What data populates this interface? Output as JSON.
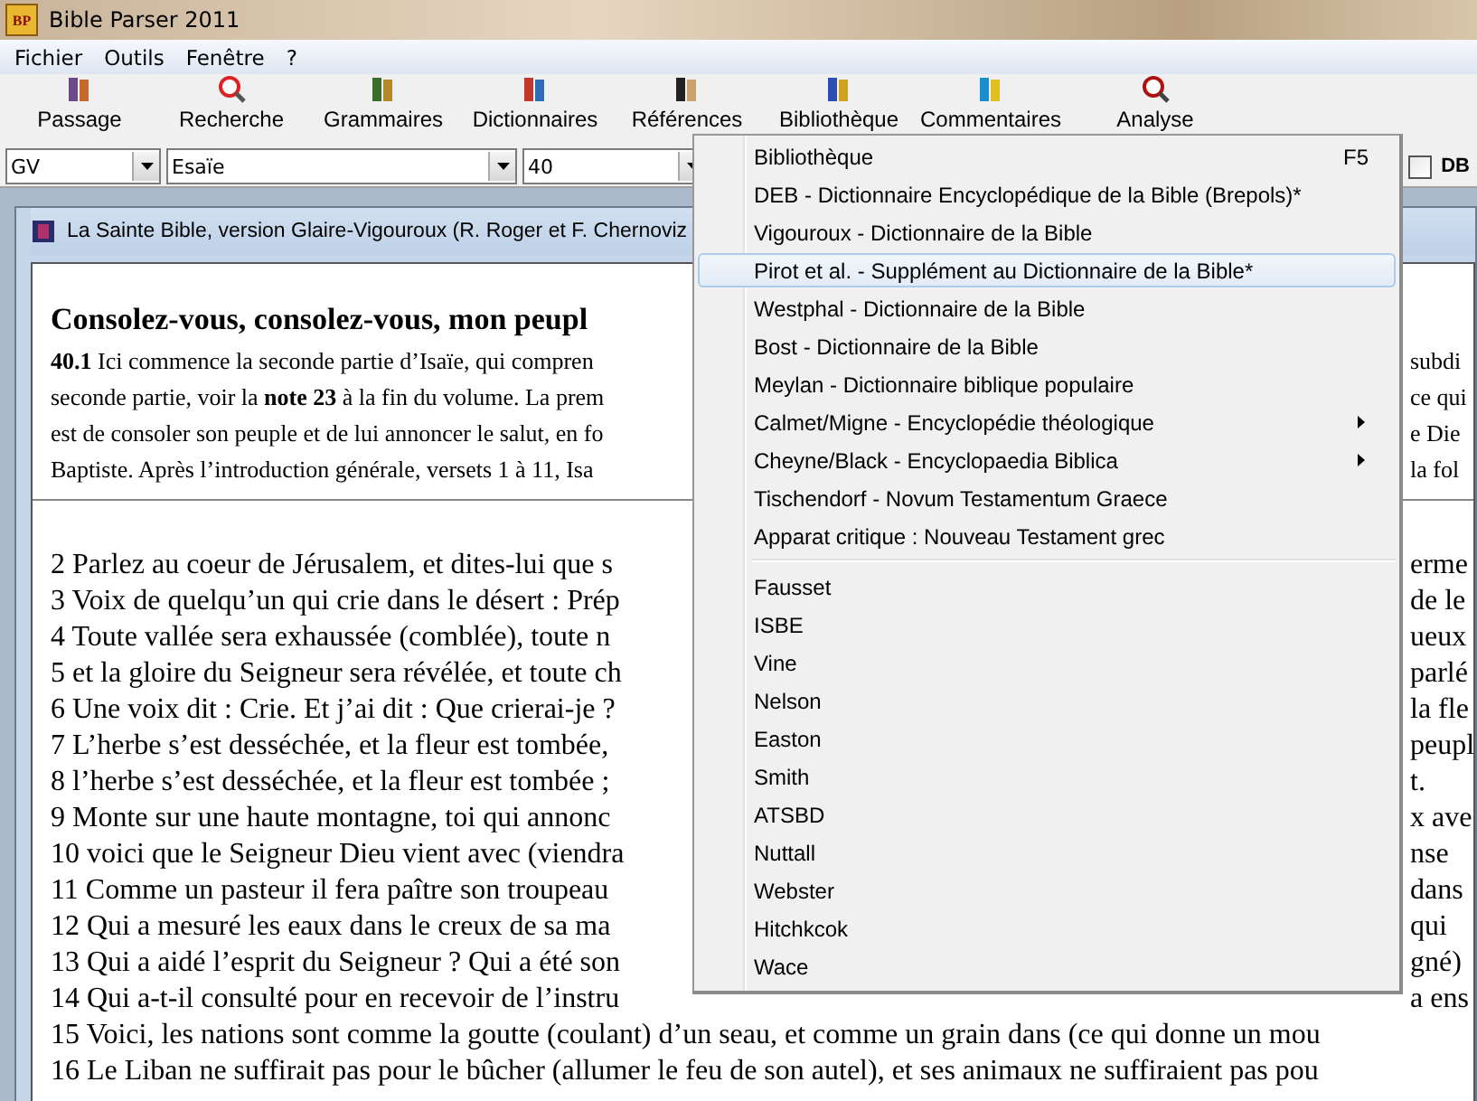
{
  "window": {
    "title": "Bible Parser 2011",
    "logo": "BP"
  },
  "menu_bar": [
    "Fichier",
    "Outils",
    "Fenêtre",
    "?"
  ],
  "toolbar": [
    {
      "label": "Passage"
    },
    {
      "label": "Recherche"
    },
    {
      "label": "Grammaires"
    },
    {
      "label": "Dictionnaires"
    },
    {
      "label": "Références"
    },
    {
      "label": "Bibliothèque"
    },
    {
      "label": "Commentaires"
    },
    {
      "label": "Analyse"
    }
  ],
  "selectors": [
    {
      "value": "GV"
    },
    {
      "value": "Esaïe"
    },
    {
      "value": "40"
    }
  ],
  "db_checkbox": {
    "label": "DB",
    "checked": false
  },
  "document_window": {
    "title": "La Sainte Bible, version Glaire-Vigouroux (R. Roger et F. Chernoviz",
    "heading": "Consolez-vous, consolez-vous, mon peupl",
    "intro": [
      {
        "text": "**40.1** Ici commence la seconde partie d’Isaïe, qui compren",
        "right": "subdi"
      },
      {
        "text": "seconde partie, voir la **note 23** à la fin du volume. La prem",
        "right": "ce qui"
      },
      {
        "text": "est de consoler son peuple et de lui annoncer le salut, en fo",
        "right": "e Die"
      },
      {
        "text": "Baptiste. Après l’introduction générale, versets 1 à 11, Isa",
        "right": "la fol"
      }
    ],
    "verses": [
      {
        "text": "2 Parlez au coeur de Jérusalem, et dites-lui que s",
        "right": "erme"
      },
      {
        "text": "3 Voix de quelqu’un qui crie dans le désert : Prép",
        "right": "de le"
      },
      {
        "text": "4 Toute vallée sera exhaussée (comblée), toute n",
        "right": "ueux"
      },
      {
        "text": "5 et la gloire du Seigneur sera révélée, et toute ch",
        "right": "parlé"
      },
      {
        "text": "6 Une voix dit : Crie. Et j’ai dit : Que crierai-je ?",
        "right": "la fle"
      },
      {
        "text": "7 L’herbe s’est desséchée, et la fleur est tombée,",
        "right": "peupl"
      },
      {
        "text": "8 l’herbe s’est desséchée, et la fleur est tombée ;",
        "right": "t."
      },
      {
        "text": "9 Monte sur une haute montagne, toi qui annonc",
        "right": "x ave"
      },
      {
        "text": "10 voici que le Seigneur Dieu vient avec (viendra",
        "right": "nse"
      },
      {
        "text": "11 Comme un pasteur il fera paître son troupeau",
        "right": "dans"
      },
      {
        "text": "12 Qui a mesuré les eaux dans le creux de sa ma",
        "right": "qui"
      },
      {
        "text": "13 Qui a aidé l’esprit du Seigneur ? Qui a été son",
        "right": "gné)"
      },
      {
        "text": "14 Qui a-t-il consulté pour en recevoir de l’instru",
        "right": "a ens"
      },
      {
        "text": "15 Voici, les nations sont comme la goutte (coulant) d’un seau, et comme un grain dans (ce qui donne un mou"
      },
      {
        "text": "16 Le Liban ne suffirait pas pour le bûcher (allumer le feu de son autel), et ses animaux ne suffiraient pas pou"
      }
    ]
  },
  "context_menu": [
    {
      "kind": "item",
      "label": "Bibliothèque",
      "shortcut": "F5",
      "selected": false
    },
    {
      "kind": "item",
      "label": "DEB - Dictionnaire Encyclopédique de la Bible (Brepols)*",
      "selected": false
    },
    {
      "kind": "item",
      "label": "Vigouroux - Dictionnaire de la Bible",
      "selected": false
    },
    {
      "kind": "item",
      "label": "Pirot et al. - Supplément au Dictionnaire de la Bible*",
      "selected": true
    },
    {
      "kind": "item",
      "label": "Westphal - Dictionnaire de la Bible",
      "selected": false
    },
    {
      "kind": "item",
      "label": "Bost - Dictionnaire de la Bible",
      "selected": false
    },
    {
      "kind": "item",
      "label": "Meylan - Dictionnaire biblique populaire",
      "selected": false
    },
    {
      "kind": "submenu",
      "label": "Calmet/Migne - Encyclopédie théologique",
      "selected": false
    },
    {
      "kind": "submenu",
      "label": "Cheyne/Black - Encyclopaedia Biblica",
      "selected": false
    },
    {
      "kind": "item",
      "label": "Tischendorf - Novum Testamentum Graece",
      "selected": false
    },
    {
      "kind": "item",
      "label": "Apparat critique : Nouveau Testament grec",
      "selected": false
    },
    {
      "kind": "separator"
    },
    {
      "kind": "item",
      "label": "Fausset",
      "selected": false
    },
    {
      "kind": "item",
      "label": "ISBE",
      "selected": false
    },
    {
      "kind": "item",
      "label": "Vine",
      "selected": false
    },
    {
      "kind": "item",
      "label": "Nelson",
      "selected": false
    },
    {
      "kind": "item",
      "label": "Easton",
      "selected": false
    },
    {
      "kind": "item",
      "label": "Smith",
      "selected": false
    },
    {
      "kind": "item",
      "label": "ATSBD",
      "selected": false
    },
    {
      "kind": "item",
      "label": "Nuttall",
      "selected": false
    },
    {
      "kind": "item",
      "label": "Webster",
      "selected": false
    },
    {
      "kind": "item",
      "label": "Hitchkcok",
      "selected": false
    },
    {
      "kind": "item",
      "label": "Wace",
      "selected": false
    }
  ]
}
